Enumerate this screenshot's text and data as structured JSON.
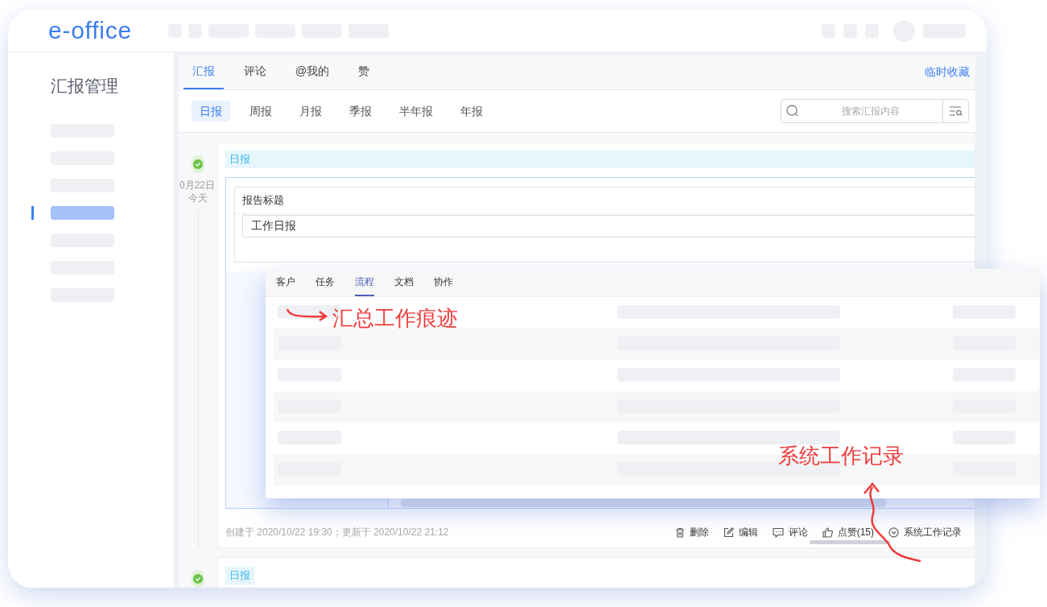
{
  "logo": "e-office",
  "sidebar": {
    "title": "汇报管理",
    "items": [
      {
        "selected": false
      },
      {
        "selected": false
      },
      {
        "selected": false
      },
      {
        "selected": true
      },
      {
        "selected": false
      },
      {
        "selected": false
      },
      {
        "selected": false
      }
    ]
  },
  "tabs": [
    {
      "label": "汇报",
      "selected": true
    },
    {
      "label": "评论",
      "selected": false
    },
    {
      "label": "@我的",
      "selected": false
    },
    {
      "label": "赞",
      "selected": false
    }
  ],
  "favorites_link": "临时收藏",
  "report_types": [
    {
      "label": "日报",
      "selected": true
    },
    {
      "label": "周报",
      "selected": false
    },
    {
      "label": "月报",
      "selected": false
    },
    {
      "label": "季报",
      "selected": false
    },
    {
      "label": "半年报",
      "selected": false
    },
    {
      "label": "年报",
      "selected": false
    }
  ],
  "search": {
    "placeholder": "搜索汇报内容"
  },
  "reports": [
    {
      "date": "0月22日",
      "day": "今天",
      "tag": "日报",
      "title_label": "报告标题",
      "title_value": "工作日报",
      "meta": "创建于 2020/10/22 19:30；更新于 2020/10/22 21:12",
      "actions": [
        {
          "kind": "delete",
          "label": "删除"
        },
        {
          "kind": "edit",
          "label": "编辑"
        },
        {
          "kind": "comment",
          "label": "评论"
        },
        {
          "kind": "like",
          "label": "点赞(15)"
        },
        {
          "kind": "log",
          "label": "系统工作记录"
        }
      ]
    },
    {
      "tag": "日报"
    }
  ],
  "popup": {
    "tabs": [
      {
        "label": "客户",
        "selected": false
      },
      {
        "label": "任务",
        "selected": false
      },
      {
        "label": "流程",
        "selected": true
      },
      {
        "label": "文档",
        "selected": false
      },
      {
        "label": "协作",
        "selected": false
      }
    ]
  },
  "annotations": [
    {
      "text": "汇总工作痕迹"
    },
    {
      "text": "系统工作记录"
    }
  ]
}
